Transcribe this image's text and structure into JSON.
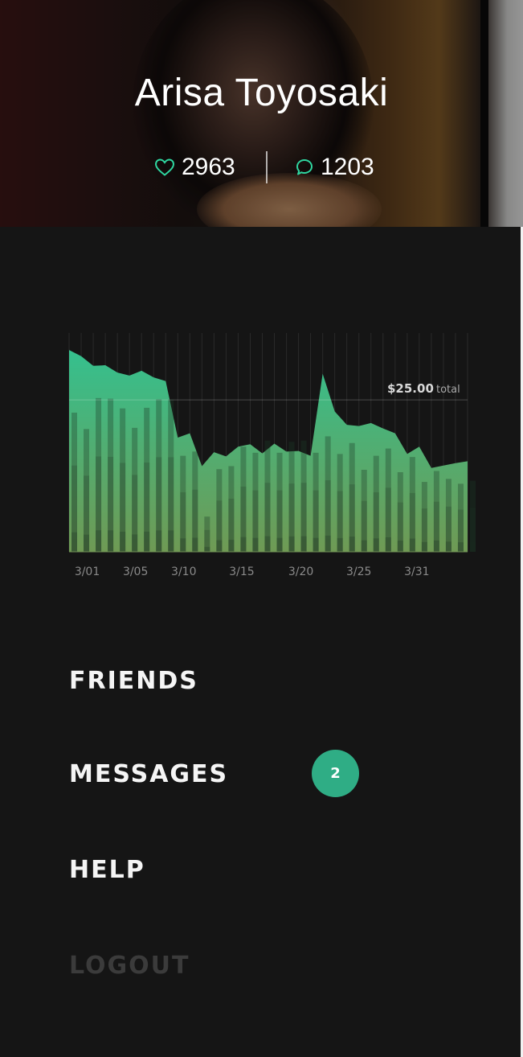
{
  "profile": {
    "name": "Arisa Toyosaki",
    "likes": "2963",
    "comments": "1203"
  },
  "colors": {
    "accent": "#2fad85",
    "area_top": "#35c08e",
    "area_bottom": "#6f9a54",
    "background": "#151515",
    "logout": "#3b3b3b"
  },
  "icons": {
    "likes": "heart-outline-icon",
    "comments": "speech-bubble-icon"
  },
  "chart_data": {
    "type": "area",
    "annotation": {
      "value": "$25.00",
      "label": "total",
      "y": 25
    },
    "tick_labels": [
      "3/01",
      "3/05",
      "3/10",
      "3/15",
      "3/20",
      "3/25",
      "3/31"
    ],
    "tick_index": [
      1.5,
      5.5,
      9.5,
      14.3,
      19.2,
      24,
      28.8
    ],
    "ylim": [
      0,
      36
    ],
    "grid": "vertical",
    "area_values": [
      33.2,
      32.2,
      30.6,
      30.7,
      29.5,
      29.0,
      29.8,
      28.7,
      28.1,
      18.8,
      19.5,
      14.1,
      16.4,
      15.7,
      17.3,
      17.7,
      16.2,
      17.8,
      16.5,
      16.6,
      15.8,
      29.3,
      23.1,
      20.9,
      20.7,
      21.2,
      20.3,
      19.5,
      16.1,
      17.3,
      13.8,
      14.2,
      14.6,
      14.9
    ],
    "bar_values": [
      22.9,
      20.2,
      25.3,
      25.2,
      23.6,
      20.4,
      23.7,
      25.1,
      25.1,
      15.8,
      16.5,
      5.8,
      13.6,
      14.1,
      17.3,
      16.3,
      18.3,
      16.3,
      18.1,
      18.3,
      16.3,
      19.0,
      16.1,
      17.9,
      13.5,
      15.8,
      17.0,
      13.1,
      15.6,
      11.5,
      13.3,
      12.0,
      11.2,
      11.7
    ]
  },
  "menu": {
    "friends": "FRIENDS",
    "messages": "MESSAGES",
    "messages_badge": "2",
    "help": "HELP",
    "logout": "LOGOUT"
  }
}
